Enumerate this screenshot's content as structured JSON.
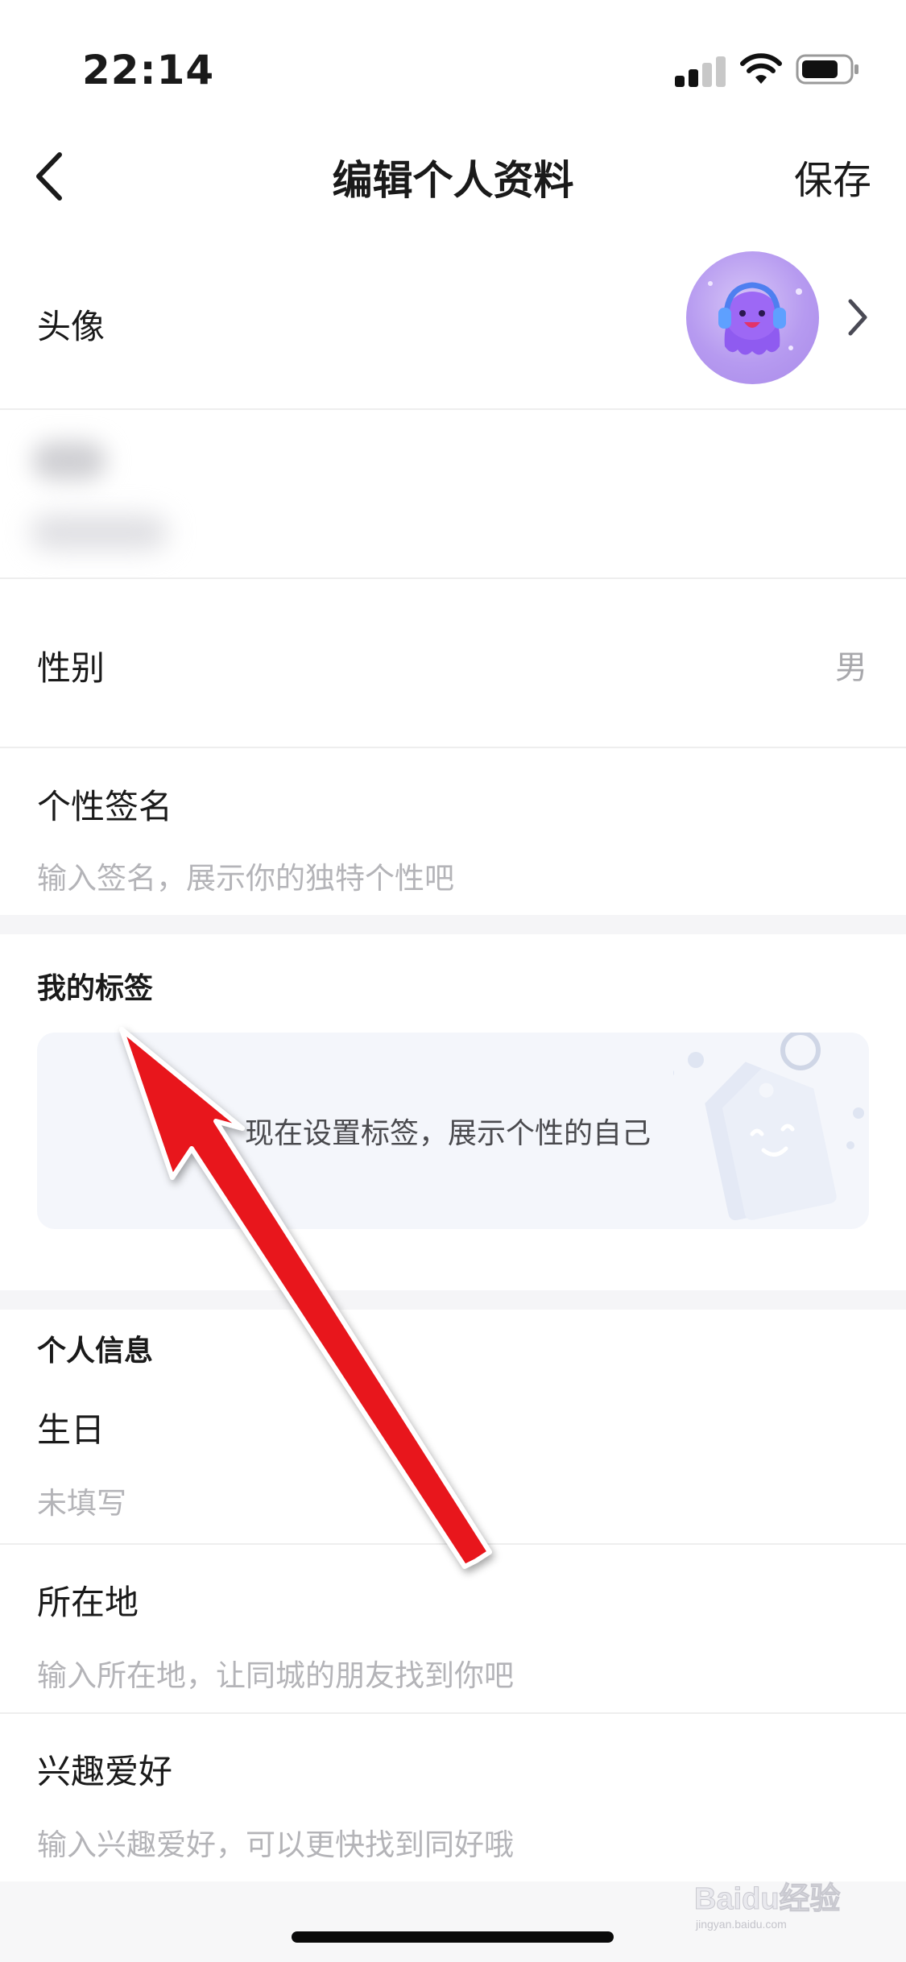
{
  "status": {
    "time": "22:14"
  },
  "nav": {
    "title": "编辑个人资料",
    "save_label": "保存"
  },
  "avatar_row": {
    "label": "头像"
  },
  "gender_row": {
    "label": "性别",
    "value": "男"
  },
  "signature_row": {
    "label": "个性签名",
    "placeholder": "输入签名，展示你的独特个性吧"
  },
  "tags_section": {
    "title": "我的标签",
    "hint": "现在设置标签，展示个性的自己"
  },
  "info_section": {
    "title": "个人信息",
    "birthday": {
      "label": "生日",
      "value": "未填写"
    },
    "location": {
      "label": "所在地",
      "placeholder": "输入所在地，让同城的朋友找到你吧"
    },
    "hobbies": {
      "label": "兴趣爱好",
      "placeholder": "输入兴趣爱好，可以更快找到同好哦"
    }
  },
  "watermark": {
    "text": "Baidu经验",
    "subtext": "jingyan.baidu.com"
  },
  "colors": {
    "annotation_arrow": "#e8121b",
    "avatar_purple": "#b69af0",
    "section_gap": "#f5f5f7"
  }
}
